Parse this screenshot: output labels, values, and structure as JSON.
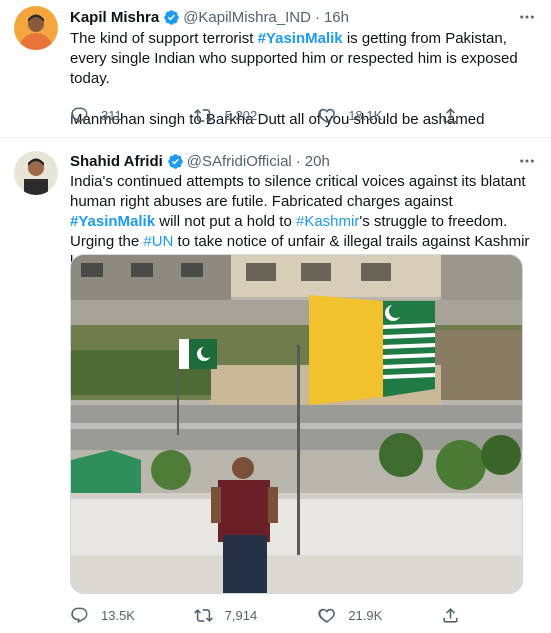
{
  "tweets": [
    {
      "name": "Kapil Mishra",
      "handle": "@KapilMishra_IND",
      "time": "16h",
      "text_before": "The kind of support terrorist ",
      "hashtag": "#YasinMalik",
      "text_after": " is getting from Pakistan, every single Indian who supported him or respected him is exposed today.",
      "text_line2": "Manmohan singh to Barkha Dutt all of you should be ashamed",
      "replies": "311",
      "retweets": "5,202",
      "likes": "18.1K"
    },
    {
      "name": "Shahid Afridi",
      "handle": "@SAfridiOfficial",
      "time": "20h",
      "text_part1": "India's continued attempts to silence critical voices against its blatant human right abuses are futile. Fabricated charges against ",
      "hashtag1": "#YasinMalik",
      "text_part2": " will not put a hold to ",
      "hashtag2": "#Kashmir",
      "text_part3": "'s struggle to freedom. Urging the ",
      "hashtag3": "#UN",
      "text_part4": " to take notice of unfair & illegal trails against Kashmir leaders.",
      "replies": "13.5K",
      "retweets": "7,914",
      "likes": "21.9K"
    }
  ],
  "colors": {
    "accent": "#1d9bf0",
    "secondary_text": "#536471",
    "divider": "#eff3f4"
  },
  "icons": [
    "verified-badge-icon",
    "more-icon",
    "reply-icon",
    "retweet-icon",
    "like-icon",
    "share-icon"
  ]
}
